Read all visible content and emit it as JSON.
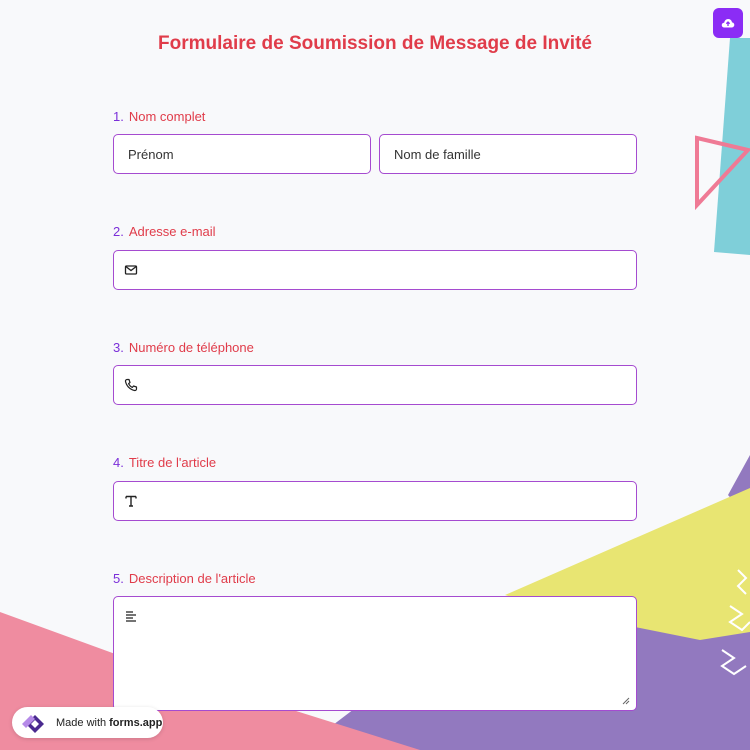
{
  "form": {
    "title": "Formulaire de Soumission de Message de Invité"
  },
  "questions": [
    {
      "number": "1.",
      "label": "Nom complet"
    },
    {
      "number": "2.",
      "label": "Adresse e-mail"
    },
    {
      "number": "3.",
      "label": "Numéro de téléphone"
    },
    {
      "number": "4.",
      "label": "Titre de l'article"
    },
    {
      "number": "5.",
      "label": "Description de l'article"
    }
  ],
  "fields": {
    "first_name_placeholder": "Prénom",
    "last_name_placeholder": "Nom de famille",
    "email_value": "",
    "phone_value": "",
    "article_title_value": "",
    "article_description_value": ""
  },
  "icons": {
    "upload": "cloud-upload-icon",
    "email": "envelope-icon",
    "phone": "phone-icon",
    "title": "text-t-icon",
    "description": "align-left-icon"
  },
  "badge": {
    "made_with": "Made with",
    "brand": "forms.app"
  },
  "colors": {
    "accent": "#8b2cf5",
    "title_red": "#e03c4a",
    "field_border": "#a54bd0",
    "background": "#f8f9fb"
  }
}
